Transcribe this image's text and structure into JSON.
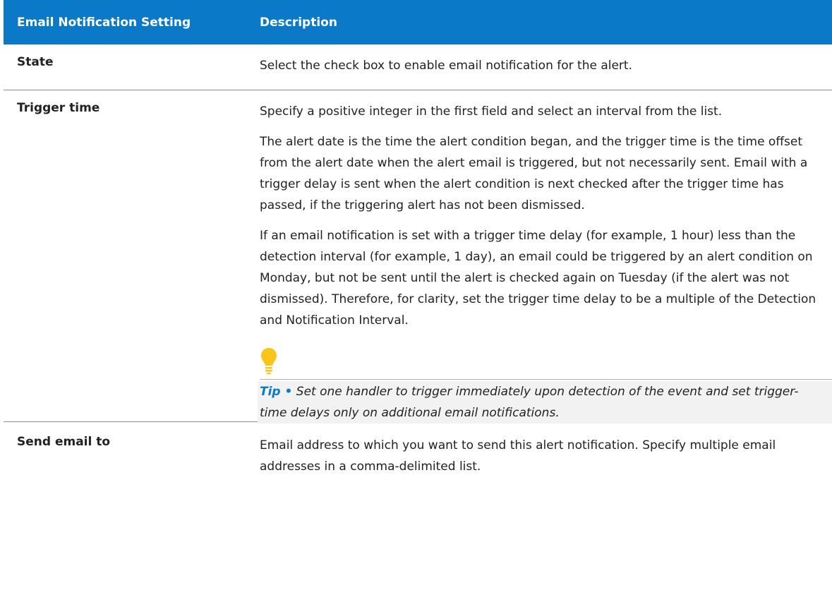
{
  "header": {
    "col1": "Email Notification Setting",
    "col2": "Description"
  },
  "rows": [
    {
      "setting": "State",
      "description": [
        "Select the check box to enable email notification for the alert."
      ]
    },
    {
      "setting": "Trigger time",
      "description": [
        "Specify a positive integer in the first field and select an interval from the list.",
        "The alert date is the time the alert condition began, and the trigger time is the time offset from the alert date when the alert email is triggered, but not necessarily sent. Email with a trigger delay is sent when the alert condition is next checked after the trigger time has passed, if the triggering alert has not been dismissed.",
        "If an email notification is set with a trigger time delay (for example, 1 hour) less than the detection interval (for example, 1 day), an email could be triggered by an alert condition on Monday, but not be sent until the alert is checked again on Tuesday (if the alert was not dismissed). Therefore, for clarity, set the trigger time delay to be a multiple of the Detection and Notification Interval."
      ],
      "tip": {
        "label": "Tip •",
        "text": "Set one handler to trigger immediately upon detection of the event and set trigger-time delays only on additional email notifications."
      }
    },
    {
      "setting": "Send email to",
      "description": [
        "Email address to which you want to send this alert notification. Specify multiple email addresses in a comma-delimited list."
      ]
    }
  ],
  "icons": {
    "tip_icon": "lightbulb-icon",
    "tip_icon_color": "#fcc419"
  },
  "colors": {
    "header_bg": "#0a7ac8",
    "header_text": "#ffffff",
    "tip_label": "#0a7ac8"
  }
}
